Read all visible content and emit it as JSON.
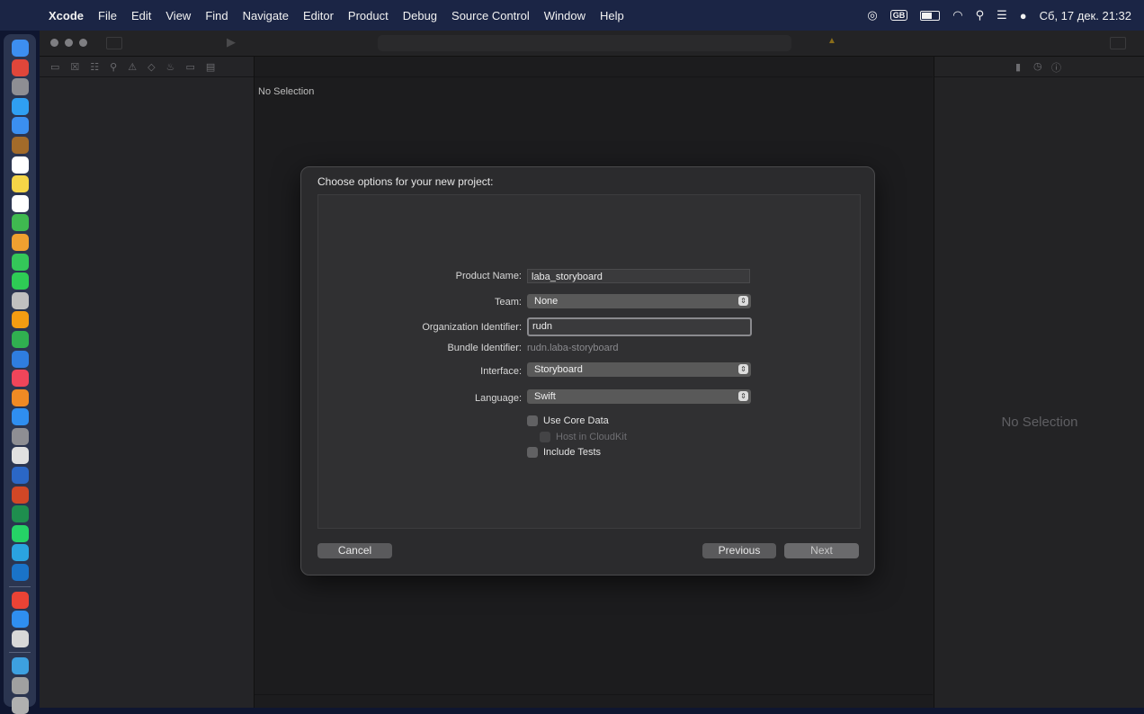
{
  "menubar": {
    "apple_glyph": "",
    "items": [
      "Xcode",
      "File",
      "Edit",
      "View",
      "Find",
      "Navigate",
      "Editor",
      "Product",
      "Debug",
      "Source Control",
      "Window",
      "Help"
    ],
    "keyboard_layout": "GB",
    "datetime": "Сб, 17 дек. 21:32"
  },
  "editor": {
    "jump_bar_text": "No Selection"
  },
  "inspector": {
    "empty_text": "No Selection"
  },
  "dialog": {
    "title": "Choose options for your new project:",
    "product_name_label": "Product Name:",
    "product_name_value": "laba_storyboard",
    "team_label": "Team:",
    "team_value": "None",
    "org_id_label": "Organization Identifier:",
    "org_id_value": "rudn",
    "bundle_id_label": "Bundle Identifier:",
    "bundle_id_value": "rudn.laba-storyboard",
    "interface_label": "Interface:",
    "interface_value": "Storyboard",
    "language_label": "Language:",
    "language_value": "Swift",
    "use_core_data_label": "Use Core Data",
    "host_in_cloudkit_label": "Host in CloudKit",
    "include_tests_label": "Include Tests",
    "cancel_label": "Cancel",
    "previous_label": "Previous",
    "next_label": "Next"
  },
  "colors": {
    "desktop": "#0f1630",
    "menubar": "#1b2545",
    "dock": "#2b3550",
    "window": "#1c1c1e",
    "sheet": "#2b2b2d"
  },
  "dock_icons": [
    {
      "name": "finder-icon",
      "color": "#3d8ef0"
    },
    {
      "name": "launchpad-icon",
      "color": "#e0463a"
    },
    {
      "name": "launchpad-grid-icon",
      "color": "#8e8e93"
    },
    {
      "name": "safari-icon",
      "color": "#2f9ff2"
    },
    {
      "name": "mail-icon",
      "color": "#3b8ff0"
    },
    {
      "name": "notes-brown-icon",
      "color": "#a36b2a"
    },
    {
      "name": "calendar-icon",
      "color": "#ffffff"
    },
    {
      "name": "notes-icon",
      "color": "#f5d547"
    },
    {
      "name": "reminders-icon",
      "color": "#ffffff"
    },
    {
      "name": "maps-icon",
      "color": "#3fb950"
    },
    {
      "name": "photos-icon",
      "color": "#f0a030"
    },
    {
      "name": "messages-icon",
      "color": "#34c759"
    },
    {
      "name": "facetime-icon",
      "color": "#2ecc55"
    },
    {
      "name": "automator-icon",
      "color": "#c0c0c0"
    },
    {
      "name": "pages-icon",
      "color": "#f39c12"
    },
    {
      "name": "numbers-icon",
      "color": "#30b050"
    },
    {
      "name": "keynote-icon",
      "color": "#2f7de0"
    },
    {
      "name": "music-icon",
      "color": "#f0455a"
    },
    {
      "name": "books-icon",
      "color": "#f08a24"
    },
    {
      "name": "app-store-icon",
      "color": "#2f8ef0"
    },
    {
      "name": "system-settings-icon",
      "color": "#8e8e93"
    },
    {
      "name": "find-my-icon",
      "color": "#e0e0e0"
    },
    {
      "name": "word-icon",
      "color": "#2b67c6"
    },
    {
      "name": "powerpoint-icon",
      "color": "#d24726"
    },
    {
      "name": "excel-icon",
      "color": "#1e8e4e"
    },
    {
      "name": "whatsapp-icon",
      "color": "#25d366"
    },
    {
      "name": "telegram-icon",
      "color": "#2aa3e0"
    },
    {
      "name": "outlook-icon",
      "color": "#1a73c8"
    },
    {
      "name": "chrome-icon",
      "color": "#ea4335"
    },
    {
      "name": "xcode-icon",
      "color": "#2f8ef0"
    },
    {
      "name": "preview-icon",
      "color": "#d8d8d8"
    },
    {
      "name": "downloads-folder-icon",
      "color": "#3da0e0"
    },
    {
      "name": "document-stack-icon",
      "color": "#a0a0a0"
    },
    {
      "name": "trash-icon",
      "color": "#b0b0b0"
    }
  ]
}
